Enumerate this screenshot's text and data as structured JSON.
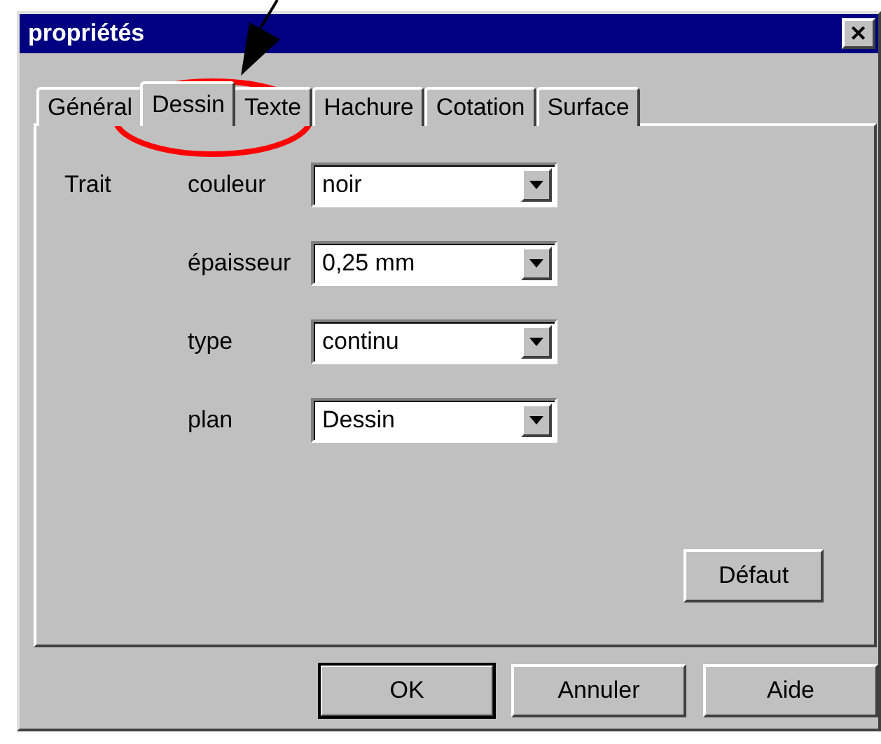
{
  "window": {
    "title": "propriétés",
    "close": "✕"
  },
  "tabs": [
    {
      "label": "Général",
      "selected": false
    },
    {
      "label": "Dessin",
      "selected": true
    },
    {
      "label": "Texte",
      "selected": false
    },
    {
      "label": "Hachure",
      "selected": false
    },
    {
      "label": "Cotation",
      "selected": false
    },
    {
      "label": "Surface",
      "selected": false
    }
  ],
  "group": {
    "label": "Trait",
    "fields": [
      {
        "label": "couleur",
        "value": "noir"
      },
      {
        "label": "épaisseur",
        "value": "0,25 mm"
      },
      {
        "label": "type",
        "value": "continu"
      },
      {
        "label": "plan",
        "value": "Dessin"
      }
    ]
  },
  "panel_button": "Défaut",
  "buttons": [
    {
      "label": "OK",
      "default": true
    },
    {
      "label": "Annuler",
      "default": false
    },
    {
      "label": "Aide",
      "default": false
    }
  ]
}
